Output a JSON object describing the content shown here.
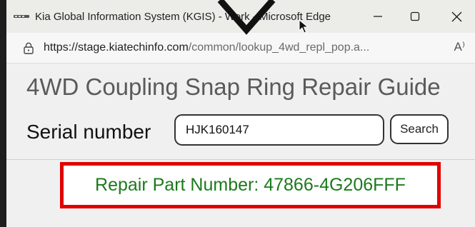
{
  "window": {
    "title": "Kia Global Information System (KGIS) - Work - Microsoft Edge"
  },
  "addressbar": {
    "url_host": "https://stage.kiatechinfo.com",
    "url_path": "/common/lookup_4wd_repl_pop.a...",
    "read_aloud_label": "A⁾"
  },
  "page": {
    "title": "4WD Coupling Snap Ring Repair Guide",
    "serial_label": "Serial number",
    "serial_value": "HJK160147",
    "search_label": "Search",
    "result_text": "Repair Part Number: 47866-4G206FFF"
  },
  "colors": {
    "titlebar_bg": "#ecece9",
    "result_border": "#e00000",
    "result_text": "#1b7a1b"
  }
}
